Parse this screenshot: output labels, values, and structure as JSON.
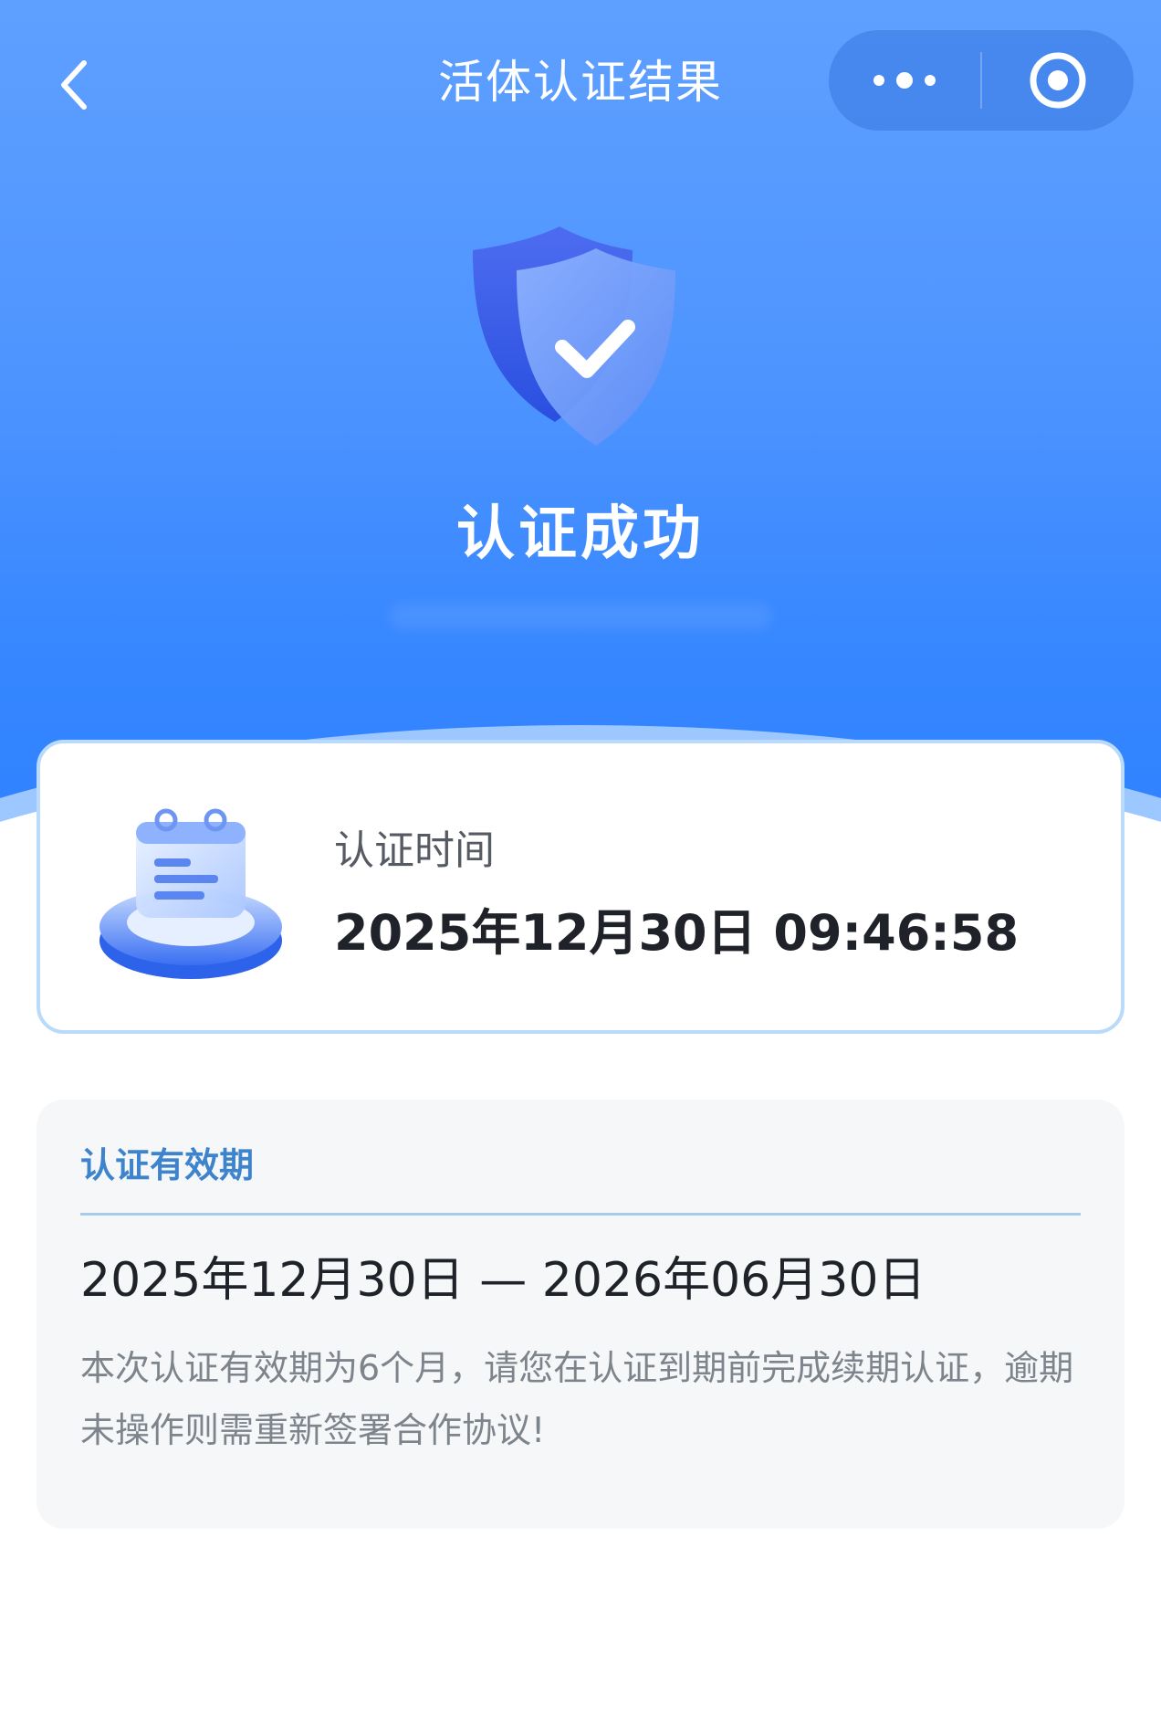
{
  "nav": {
    "title": "活体认证结果",
    "back_icon": "chevron-left-icon",
    "more_icon": "more-dots-icon",
    "close_icon": "target-circle-icon"
  },
  "hero": {
    "icon": "shield-check-icon",
    "title": "认证成功"
  },
  "time_card": {
    "icon": "calendar-icon",
    "label": "认证时间",
    "value": "2025年12月30日 09:46:58"
  },
  "validity_card": {
    "label": "认证有效期",
    "range": "2025年12月30日 — 2026年06月30日",
    "note": "本次认证有效期为6个月，请您在认证到期前完成续期认证，逾期未操作则需重新签署合作协议!"
  },
  "colors": {
    "hero_top": "#5ea0ff",
    "hero_bottom": "#2f80ff",
    "accent": "#3e84cc",
    "card_border": "#b9dafb",
    "card_bg": "#f5f7f9"
  }
}
